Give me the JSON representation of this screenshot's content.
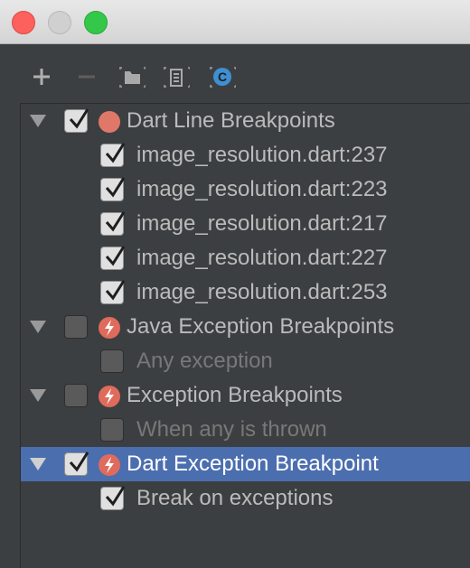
{
  "toolbar": {
    "buttons": [
      {
        "name": "add-icon",
        "glyph": "+"
      },
      {
        "name": "remove-icon",
        "glyph": "−"
      },
      {
        "name": "folder-icon"
      },
      {
        "name": "clipboard-icon"
      },
      {
        "name": "class-icon",
        "glyph": "C"
      }
    ]
  },
  "tree": {
    "dart_line": {
      "label": "Dart Line Breakpoints",
      "checked": true,
      "items": [
        {
          "label": "image_resolution.dart:237",
          "checked": true
        },
        {
          "label": "image_resolution.dart:223",
          "checked": true
        },
        {
          "label": "image_resolution.dart:217",
          "checked": true
        },
        {
          "label": "image_resolution.dart:227",
          "checked": true
        },
        {
          "label": "image_resolution.dart:253",
          "checked": true
        }
      ]
    },
    "java_exception": {
      "label": "Java Exception Breakpoints",
      "checked": false,
      "items": [
        {
          "label": "Any exception",
          "checked": false
        }
      ]
    },
    "exception": {
      "label": "Exception Breakpoints",
      "checked": false,
      "items": [
        {
          "label": "When any is thrown",
          "checked": false
        }
      ]
    },
    "dart_exception": {
      "label": "Dart Exception Breakpoint",
      "checked": true,
      "selected": true,
      "items": [
        {
          "label": "Break on exceptions",
          "checked": true
        }
      ]
    }
  },
  "colors": {
    "selection": "#4b6eaf",
    "background": "#3c3f41"
  }
}
